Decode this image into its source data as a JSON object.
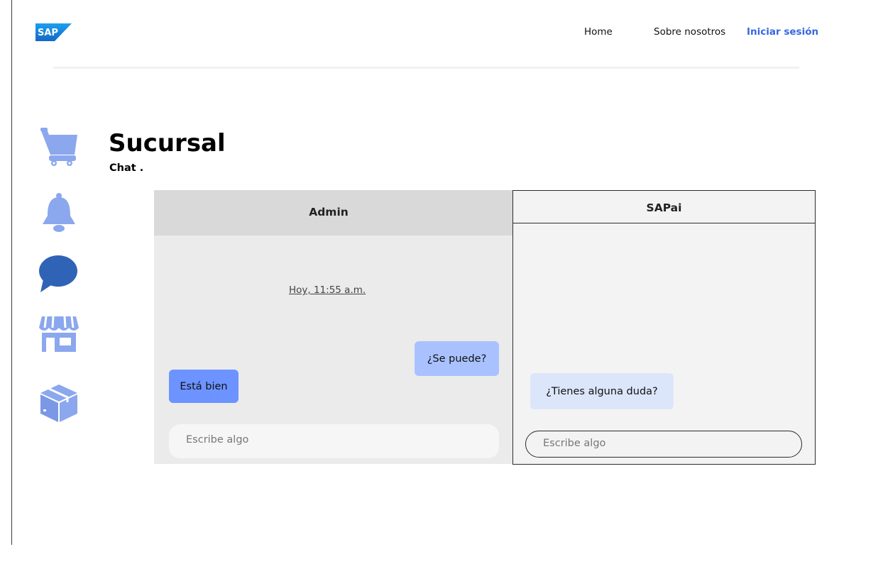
{
  "header": {
    "logo_text": "SAP",
    "nav": {
      "home": "Home",
      "about": "Sobre nosotros",
      "login": "Iniciar sesión"
    }
  },
  "sidebar": {
    "icons": [
      "cart-icon",
      "bell-icon",
      "chat-icon",
      "store-icon",
      "box-icon"
    ],
    "accent_light": "#8ba7ee",
    "accent_dark": "#2f63b6"
  },
  "page": {
    "title": "Sucursal",
    "subtitle": "Chat ."
  },
  "admin_chat": {
    "title": "Admin",
    "timestamp": "Hoy, 11:55 a.m.",
    "messages": [
      {
        "text": "¿Se puede?",
        "side": "right"
      },
      {
        "text": "Está bien",
        "side": "left"
      }
    ],
    "input_placeholder": "Escribe algo"
  },
  "sapai_chat": {
    "title": "SAPai",
    "messages": [
      {
        "text": "¿Tienes alguna duda?",
        "side": "left"
      }
    ],
    "input_placeholder": "Escribe algo"
  },
  "colors": {
    "link_blue": "#3568e0",
    "bubble_sent": "#a9c2ff",
    "bubble_received": "#6c93ff",
    "bubble_ai": "#dce6fb"
  }
}
